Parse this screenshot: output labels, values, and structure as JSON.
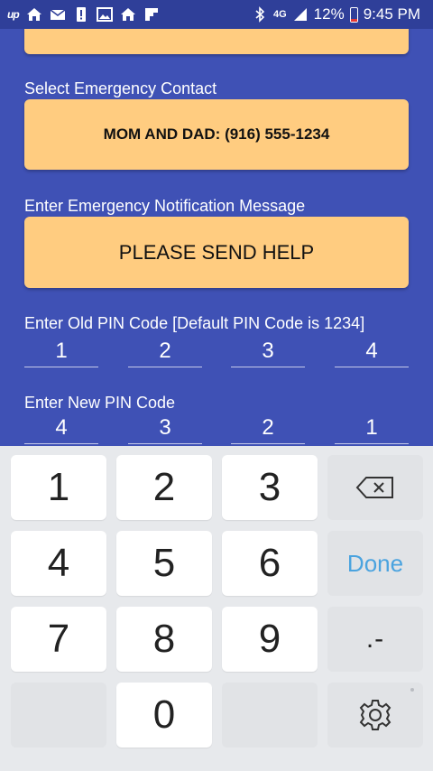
{
  "status_bar": {
    "carrier_glyph": "up",
    "network": "4G",
    "battery": "12%",
    "time": "9:45 PM",
    "icons_left": [
      "up-icon",
      "home-icon",
      "mail-icon",
      "alert-icon",
      "image-icon",
      "home-icon",
      "flipboard-icon"
    ],
    "icons_right": [
      "bluetooth-icon",
      "lte-icon",
      "signal-icon",
      "battery-icon"
    ]
  },
  "form": {
    "emergency_contact_label": "Select Emergency Contact",
    "emergency_contact_value": "MOM AND DAD: (916) 555-1234",
    "message_label": "Enter Emergency Notification Message",
    "message_value": "PLEASE SEND HELP",
    "old_pin_label": "Enter Old PIN Code [Default PIN Code is 1234]",
    "old_pin_digits": [
      "1",
      "2",
      "3",
      "4"
    ],
    "new_pin_label": "Enter New PIN Code",
    "new_pin_digits": [
      "4",
      "3",
      "2",
      "1"
    ]
  },
  "keyboard": {
    "keys": [
      "1",
      "2",
      "3",
      "4",
      "5",
      "6",
      "7",
      "8",
      "9",
      "0"
    ],
    "done_label": "Done",
    "dotdash_label": ".-",
    "icons": [
      "backspace-icon",
      "gear-icon"
    ]
  },
  "colors": {
    "background": "#3f51b5",
    "status_bar": "#2f3f99",
    "button": "#ffcc80",
    "done_text": "#4aa3df"
  }
}
